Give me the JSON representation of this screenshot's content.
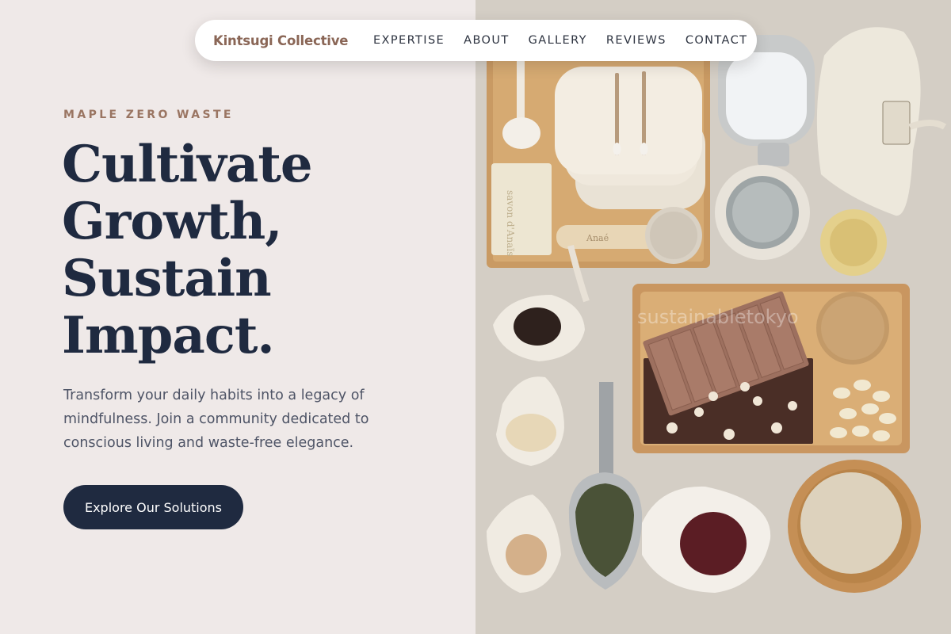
{
  "nav": {
    "brand": "Kintsugi Collective",
    "links": [
      "EXPERTISE",
      "ABOUT",
      "GALLERY",
      "REVIEWS",
      "CONTACT"
    ]
  },
  "hero": {
    "eyebrow": "MAPLE ZERO WASTE",
    "headline_lines": [
      "Cultivate",
      "Growth,",
      "Sustain",
      "Impact."
    ],
    "subtext": "Transform your daily habits into a legacy of mindfulness. Join a community dedicated to conscious living and waste-free elegance.",
    "cta_label": "Explore Our Solutions"
  },
  "photo": {
    "watermark": "sustainabletokyo",
    "soap_text": "savon d'Anaïs",
    "brush_text": "Anaé"
  },
  "colors": {
    "background": "#efe9e8",
    "navy": "#1f2a40",
    "brand_brown": "#8a6656",
    "eyebrow": "#9a7562"
  }
}
